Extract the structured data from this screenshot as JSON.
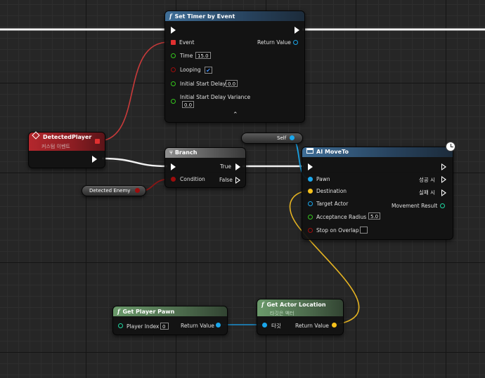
{
  "set_timer": {
    "title": "Set Timer by Event",
    "event_label": "Event",
    "time_label": "Time",
    "time_value": "15.0",
    "looping_label": "Looping",
    "initial_start_delay_label": "Initial Start Delay",
    "initial_start_delay_value": "0.0",
    "initial_start_delay_variance_label": "Initial Start Delay Variance",
    "initial_start_delay_variance_value": "0.0",
    "return_value_label": "Return Value",
    "expand_glyph": "⌃"
  },
  "detected_player": {
    "title": "DetectedPlayer",
    "subtitle": "커스텀 이벤트"
  },
  "branch": {
    "title": "Branch",
    "condition_label": "Condition",
    "true_label": "True",
    "false_label": "False"
  },
  "detected_enemy_var": {
    "label": "Detected Enemy"
  },
  "self_var": {
    "label": "Self"
  },
  "ai_move_to": {
    "title": "AI MoveTo",
    "pawn_label": "Pawn",
    "destination_label": "Destination",
    "target_actor_label": "Target Actor",
    "acceptance_radius_label": "Acceptance Radius",
    "acceptance_radius_value": "5.0",
    "stop_on_overlap_label": "Stop on Overlap",
    "on_success_label": "성공 시",
    "on_fail_label": "실패 시",
    "movement_result_label": "Movement Result"
  },
  "get_player_pawn": {
    "title": "Get Player Pawn",
    "player_index_label": "Player Index",
    "player_index_value": "0",
    "return_value_label": "Return Value"
  },
  "get_actor_location": {
    "title": "Get Actor Location",
    "subtitle": "타깃은 액터",
    "target_label": "타깃",
    "return_value_label": "Return Value"
  },
  "icons": {
    "function": "function-icon",
    "event": "event-diamond-icon",
    "branch": "branch-icon",
    "latent": "clock-icon",
    "checkbox": "checkmark-icon"
  },
  "colors": {
    "exec": "#ffffff",
    "object": "#1aa7ec",
    "vector": "#f7c21c",
    "boolean": "#9b0d0d",
    "float": "#35c51d",
    "delegate": "#e03030",
    "int": "#1ed9a2"
  }
}
